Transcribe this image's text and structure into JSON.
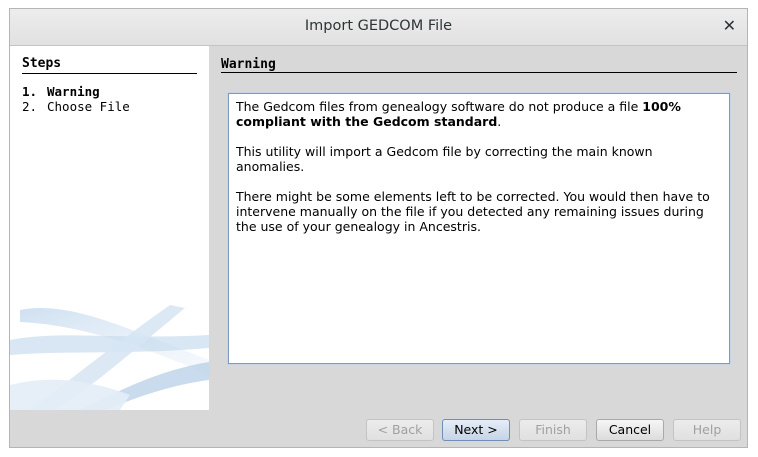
{
  "window": {
    "title": "Import GEDCOM File",
    "close_glyph": "✕"
  },
  "steps": {
    "title": "Steps",
    "items": [
      {
        "num": "1.",
        "label": "Warning"
      },
      {
        "num": "2.",
        "label": "Choose File"
      }
    ]
  },
  "content": {
    "title": "Warning",
    "p1_text": "The Gedcom files from genealogy software do not produce a file ",
    "p1_bold": "100% compliant with the Gedcom standard",
    "p1_end": ".",
    "p2": "This utility will import a Gedcom file by correcting the main known anomalies.",
    "p3": "There might be some elements left to be corrected. You would then have to intervene manually on the file if you detected any remaining issues during the use of your genealogy in Ancestris."
  },
  "buttons": {
    "back": "< Back",
    "next": "Next >",
    "finish": "Finish",
    "cancel": "Cancel",
    "help": "Help"
  },
  "colors": {
    "default_button": "#c6d4e6",
    "panel": "#ffffff",
    "dialog": "#d8d8d8"
  }
}
